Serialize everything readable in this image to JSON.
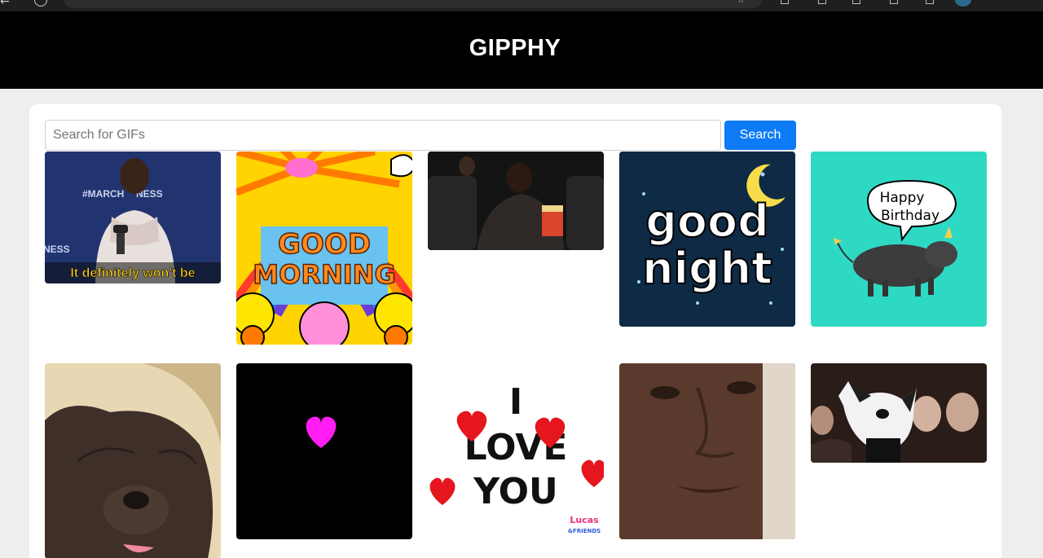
{
  "app": {
    "title": "GIPPHY"
  },
  "search": {
    "placeholder": "Search for GIFs",
    "value": "",
    "button_label": "Search"
  },
  "gifs": [
    {
      "caption": "It definitely won't be",
      "bg_text_1": "#MARCH",
      "bg_text_2": "NESS"
    },
    {
      "line1": "GOOD",
      "line2": "MORNING"
    },
    {},
    {
      "line1": "good",
      "line2": "night"
    },
    {
      "line1": "Happy",
      "line2": "Birthday"
    },
    {},
    {},
    {
      "line1": "I",
      "line2": "LOVE",
      "line3": "YOU",
      "brand1": "Lucas",
      "brand2": "&FRIENDS"
    },
    {},
    {}
  ],
  "colors": {
    "header_bg": "#000000",
    "page_bg": "#eeeeee",
    "card_bg": "#ffffff",
    "button_bg": "#0d7bf6",
    "heart": "#ff1df2",
    "goodnight_bg": "#0e2a45",
    "birthday_bg": "#2ed9c4"
  }
}
